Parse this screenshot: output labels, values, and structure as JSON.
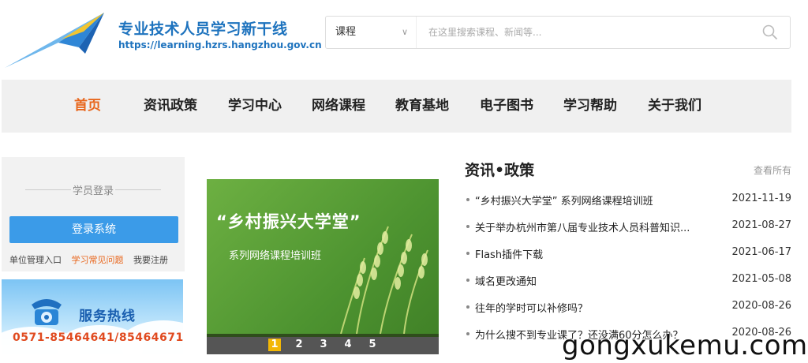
{
  "header": {
    "site_title": "专业技术人员学习新干线",
    "site_url": "https://learning.hzrs.hangzhou.gov.cn"
  },
  "search": {
    "category": "课程",
    "placeholder": "在这里搜索课程、新闻等..."
  },
  "nav": {
    "items": [
      {
        "label": "首页",
        "active": true
      },
      {
        "label": "资讯政策"
      },
      {
        "label": "学习中心"
      },
      {
        "label": "网络课程"
      },
      {
        "label": "教育基地"
      },
      {
        "label": "电子图书"
      },
      {
        "label": "学习帮助"
      },
      {
        "label": "关于我们"
      }
    ]
  },
  "login": {
    "title": "学员登录",
    "button": "登录系统",
    "links": [
      "单位管理入口",
      "学习常见问题",
      "我要注册"
    ]
  },
  "hotline": {
    "title": "服务热线",
    "phone": "0571-85464641/85464671"
  },
  "banner": {
    "title": "“乡村振兴大学堂”",
    "subtitle": "系列网络课程培训班",
    "pages": [
      "1",
      "2",
      "3",
      "4",
      "5"
    ],
    "active_page": 1
  },
  "news": {
    "title": "资讯•政策",
    "more": "查看所有",
    "items": [
      {
        "text": "“乡村振兴大学堂” 系列网络课程培训班",
        "date": "2021-11-19"
      },
      {
        "text": "关于举办杭州市第八届专业技术人员科普知识...",
        "date": "2021-08-27"
      },
      {
        "text": "Flash插件下载",
        "date": "2021-06-17"
      },
      {
        "text": "域名更改通知",
        "date": "2021-05-08"
      },
      {
        "text": "往年的学时可以补修吗？",
        "date": "2020-08-26"
      },
      {
        "text": "为什么搜不到专业课了？还没满60分怎么办？",
        "date": "2020-08-26"
      }
    ]
  },
  "watermark": "gongxukemu.com",
  "colors": {
    "brand_blue": "#1e73be",
    "accent_orange": "#e8661c",
    "login_button": "#3b9be8",
    "banner_green": "#4d9330",
    "pager_active": "#f2b705"
  }
}
